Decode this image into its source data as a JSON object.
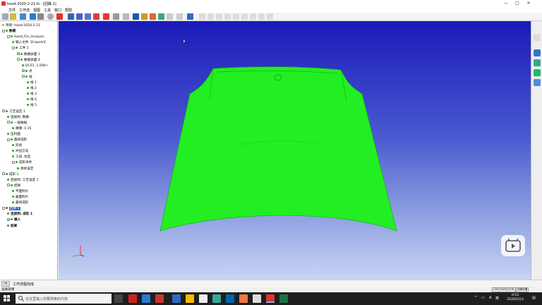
{
  "window": {
    "title": "hood-2020-2-21.fs - [回路 1]",
    "controls": [
      "—",
      "□",
      "✕"
    ]
  },
  "menu": [
    "文件",
    "工作流",
    "视图",
    "工具",
    "窗口",
    "帮助"
  ],
  "tree": {
    "items": [
      {
        "label": "项目: hood-2020-2-21",
        "indent": 0,
        "icon": "folder"
      },
      {
        "label": "数模",
        "indent": 0,
        "bold": true,
        "exp": "-"
      },
      {
        "label": "Hood_For_Analysis",
        "indent": 1,
        "exp": "-"
      },
      {
        "label": "输入文件: D:\\work\\F",
        "indent": 2
      },
      {
        "label": "工件 1",
        "indent": 2,
        "exp": "-"
      },
      {
        "label": "数模表面 1",
        "indent": 3,
        "exp": "+"
      },
      {
        "label": "数模表面 4",
        "indent": 3,
        "exp": "-"
      },
      {
        "label": "DC01, 1.000 r",
        "indent": 4
      },
      {
        "label": "点",
        "indent": 4,
        "exp": "+"
      },
      {
        "label": "线",
        "indent": 4,
        "exp": "-"
      },
      {
        "label": "线 1",
        "indent": 5
      },
      {
        "label": "线 2",
        "indent": 5
      },
      {
        "label": "线 3",
        "indent": 5
      },
      {
        "label": "线 4",
        "indent": 5
      },
      {
        "label": "线 5",
        "indent": 5
      },
      {
        "label": "工艺设定 1",
        "indent": 0,
        "exp": "-"
      },
      {
        "label": "连接到: 数模",
        "indent": 1
      },
      {
        "label": "一般数据",
        "indent": 1,
        "exp": "-"
      },
      {
        "label": "摩擦: 0.15",
        "indent": 2
      },
      {
        "label": "压料面",
        "indent": 1
      },
      {
        "label": "最终成形",
        "indent": 1,
        "exp": "-"
      },
      {
        "label": "形状",
        "indent": 2
      },
      {
        "label": "冲压方向",
        "indent": 2
      },
      {
        "label": "工具, 拉延",
        "indent": 2
      },
      {
        "label": "成形条件",
        "indent": 2,
        "exp": "-"
      },
      {
        "label": "目标设定",
        "indent": 3
      },
      {
        "label": "成形 1",
        "indent": 0,
        "exp": "-"
      },
      {
        "label": "连接到: 工艺设定 1",
        "indent": 1
      },
      {
        "label": "结果",
        "indent": 1,
        "exp": "-"
      },
      {
        "label": "平面料片",
        "indent": 2
      },
      {
        "label": "曲面料片",
        "indent": 2
      },
      {
        "label": "最终成形",
        "indent": 2
      },
      {
        "label": "回弹 1",
        "indent": 0,
        "exp": "-",
        "selected": true
      },
      {
        "label": "连接到: 成形 1",
        "indent": 1,
        "bold": true
      },
      {
        "label": "输入",
        "indent": 1,
        "bold": true,
        "exp": "+"
      },
      {
        "label": "结果",
        "indent": 1,
        "bold": true
      }
    ]
  },
  "viewport": {
    "part_color": "#22ee22",
    "bg_top": "#1a1ab8",
    "bg_bottom": "#c9d4f3"
  },
  "messages": {
    "text": "工作流程完成"
  },
  "status": {
    "text": "准备就绪",
    "indicators": [
      "CAP",
      "NUM",
      "SCRL",
      "回弹设置"
    ]
  },
  "taskbar": {
    "search_placeholder": "在这里输入你要搜索的内容",
    "clock_time": "0:53",
    "clock_date": "2020/2/23",
    "tray_lang": "A",
    "tray_ime": "英"
  }
}
